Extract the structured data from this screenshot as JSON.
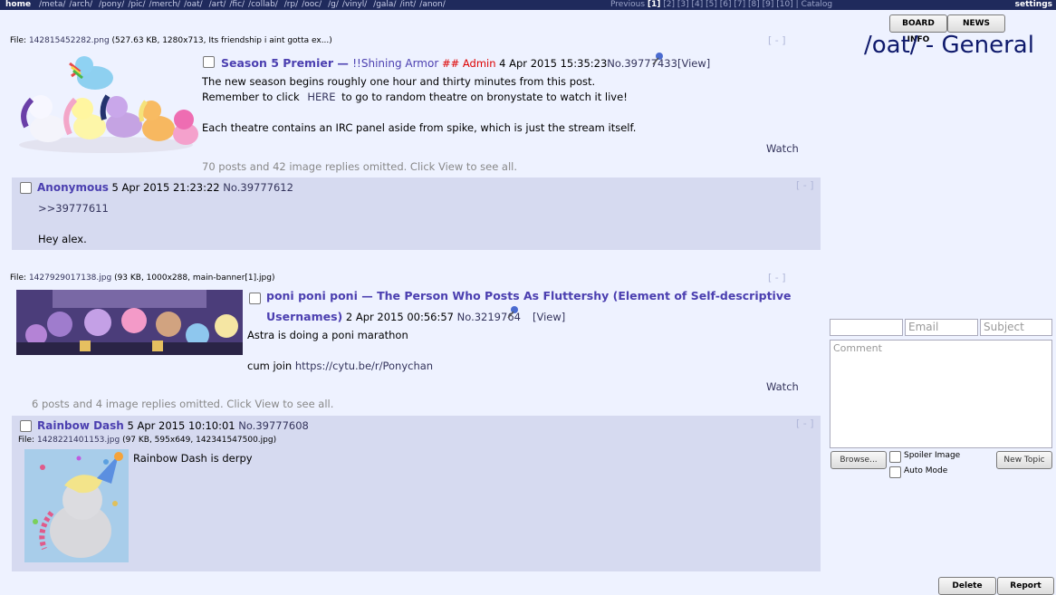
{
  "topbar": {
    "home": "home",
    "boards": [
      "/meta/",
      "/arch/",
      "/pony/",
      "/pic/",
      "/merch/",
      "/oat/",
      "/art/",
      "/fic/",
      "/collab/",
      "/rp/",
      "/ooc/",
      "/g/",
      "/vinyl/",
      "/gala/",
      "/int/",
      "/anon/"
    ],
    "pager_previous": "Previous",
    "pages": [
      "[1]",
      "[2]",
      "[3]",
      "[4]",
      "[5]",
      "[6]",
      "[7]",
      "[8]",
      "[9]",
      "[10]"
    ],
    "pager_sep": "|",
    "catalog": "Catalog",
    "settings": "settings"
  },
  "sidebar": {
    "board_info": "BOARD INFO",
    "news": "NEWS",
    "title": "/oat/ - General",
    "form": {
      "email_placeholder": "Email",
      "subject_placeholder": "Subject",
      "comment_placeholder": "Comment",
      "browse": "Browse...",
      "spoiler": "Spoiler Image",
      "auto_mode": "Auto Mode",
      "new_topic": "New Topic"
    }
  },
  "threads": [
    {
      "file_label": "File: ",
      "file_name": "142815452282.png",
      "file_meta": "(527.63 KB, 1280x713, Its friendship i aint gotta ex...)",
      "subject": "Season 5 Premier",
      "dash": " — ",
      "name": "!!Shining Armor",
      "capcode": "## Admin",
      "date": "4 Apr 2015 15:35:23",
      "no": "No.39777433",
      "view": "[View]",
      "lines": [
        "The new season begins roughly one hour and thirty minutes from this post.",
        "Remember to click",
        "HERE",
        "to go to random theatre on bronystate to watch it live!",
        "Each theatre contains an IRC panel aside from spike, which is just the stream itself."
      ],
      "watch": "Watch",
      "hide": "[ - ]",
      "omitted": "70 posts and 42 image replies omitted. Click View to see all.",
      "reply": {
        "name": "Anonymous",
        "date": "5 Apr 2015 21:23:22",
        "no": "No.39777612",
        "quote": ">>39777611",
        "text": "Hey alex.",
        "hide": "[ - ]"
      }
    },
    {
      "file_label": "File: ",
      "file_name": "1427929017138.jpg",
      "file_meta": "(93 KB, 1000x288, main-banner[1].jpg)",
      "subject_line1": "poni poni poni — The Person Who Posts As Fluttershy (Element of Self-descriptive",
      "subject_line2": "Usernames)",
      "date": "2 Apr 2015 00:56:57",
      "no": "No.3219764",
      "view": "[View]",
      "lines": [
        "Astra is doing a poni marathon",
        "cum join",
        "https://cytu.be/r/Ponychan"
      ],
      "watch": "Watch",
      "hide": "[ - ]",
      "omitted": "6 posts and 4 image replies omitted. Click View to see all.",
      "reply": {
        "name": "Rainbow Dash",
        "date": "5 Apr 2015 10:10:01",
        "no": "No.39777608",
        "file_label": "File: ",
        "file_name": "1428221401153.jpg",
        "file_meta": "(97 KB, 595x649, 142341547500.jpg)",
        "text": "Rainbow Dash is derpy",
        "hide": "[ - ]"
      }
    }
  ],
  "footer": {
    "delete": "Delete",
    "report": "Report"
  }
}
